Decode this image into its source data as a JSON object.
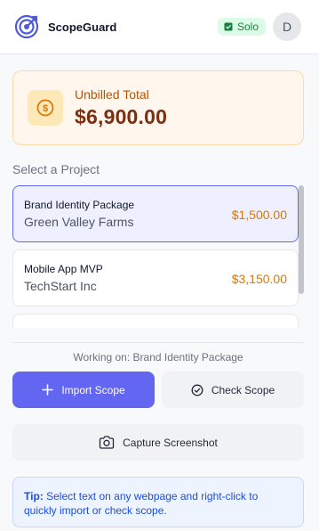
{
  "app": {
    "name": "ScopeGuard",
    "logo_icon": "target-icon"
  },
  "header": {
    "plan_badge": "Solo",
    "plan_icon": "check-square-icon",
    "avatar_initial": "D"
  },
  "summary": {
    "label": "Unbilled Total",
    "amount": "$6,900.00",
    "icon": "dollar-coin-icon"
  },
  "projects": {
    "section_label": "Select a Project",
    "items": [
      {
        "name": "Brand Identity Package",
        "client": "Green Valley Farms",
        "amount": "$1,500.00",
        "selected": true
      },
      {
        "name": "Mobile App MVP",
        "client": "TechStart Inc",
        "amount": "$3,150.00",
        "selected": false
      },
      {
        "name": "",
        "client": "",
        "amount": "",
        "selected": false
      }
    ]
  },
  "status": {
    "working_on": "Working on: Brand Identity Package"
  },
  "actions": {
    "import_label": "Import Scope",
    "check_label": "Check Scope",
    "capture_label": "Capture Screenshot"
  },
  "tip": {
    "prefix": "Tip:",
    "text": " Select text on any webpage and right-click to quickly import or check scope."
  },
  "colors": {
    "accent": "#6366f1",
    "amount": "#d97706",
    "badge_bg": "#dcfce7",
    "badge_text": "#15803d"
  }
}
